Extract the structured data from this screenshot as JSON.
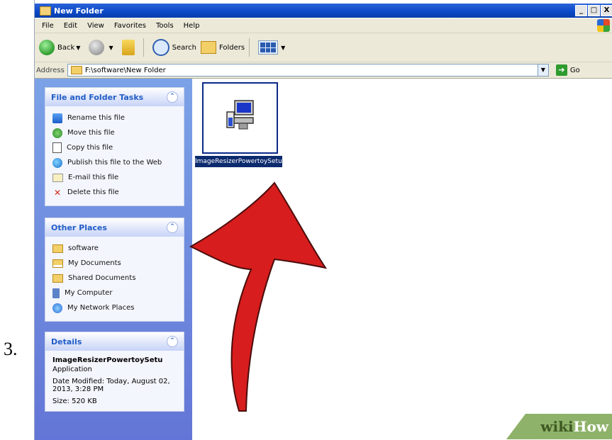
{
  "step": "3.",
  "window": {
    "title": "New Folder",
    "controls": [
      "_",
      "□",
      "X"
    ]
  },
  "menu": [
    "File",
    "Edit",
    "View",
    "Favorites",
    "Tools",
    "Help"
  ],
  "toolbar": {
    "back": "Back",
    "search": "Search",
    "folders": "Folders"
  },
  "address": {
    "label": "Address",
    "path": "F:\\software\\New Folder",
    "go": "Go"
  },
  "panes": {
    "file_tasks": {
      "title": "File and Folder Tasks",
      "items": [
        "Rename this file",
        "Move this file",
        "Copy this file",
        "Publish this file to the Web",
        "E-mail this file",
        "Delete this file"
      ]
    },
    "other_places": {
      "title": "Other Places",
      "items": [
        "software",
        "My Documents",
        "Shared Documents",
        "My Computer",
        "My Network Places"
      ]
    },
    "details": {
      "title": "Details",
      "name": "ImageResizerPowertoySetu",
      "type": "Application",
      "modified": "Date Modified: Today, August 02, 2013, 3:28 PM",
      "size": "Size: 520 KB"
    }
  },
  "file": {
    "label": "ImageResizerPowertoySetup.exe"
  },
  "watermark": {
    "a": "wiki",
    "b": "How"
  }
}
